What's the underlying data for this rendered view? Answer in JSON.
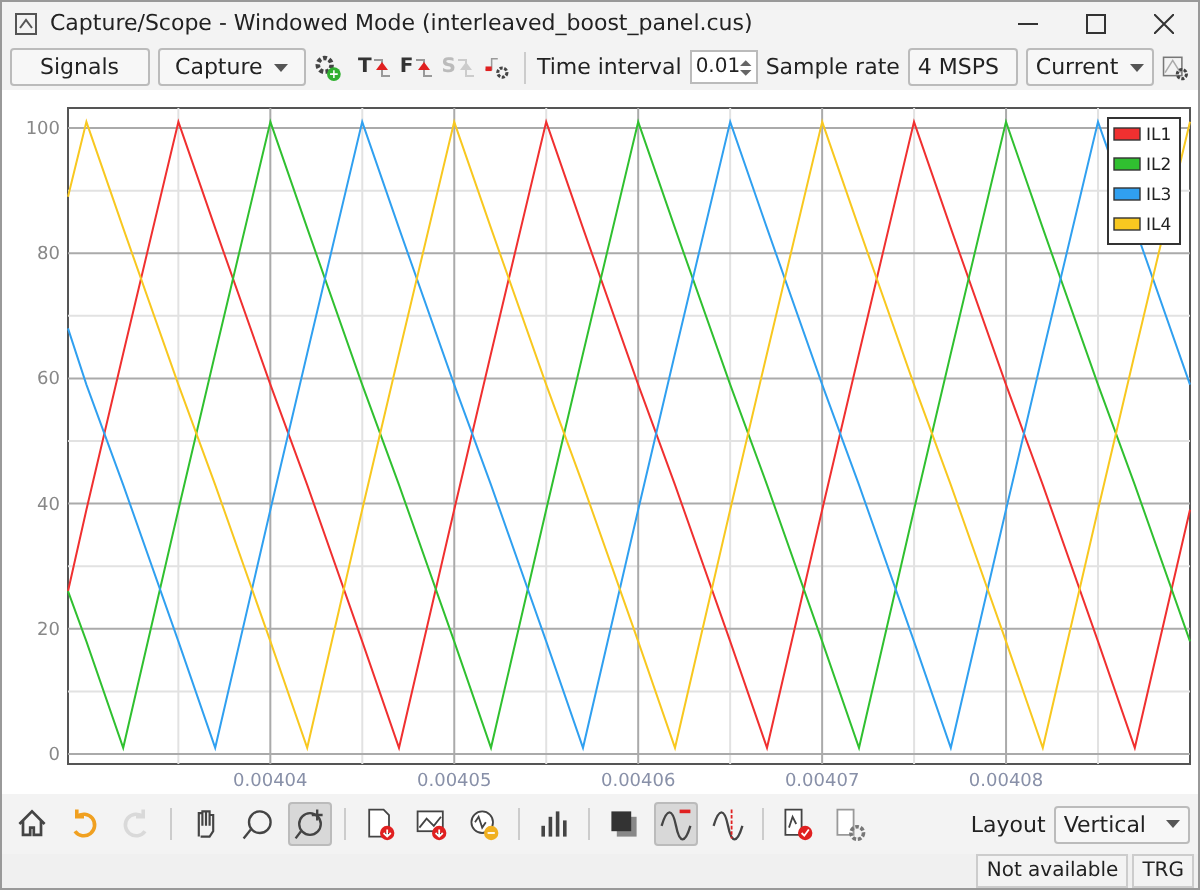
{
  "window": {
    "title": "Capture/Scope - Windowed Mode (interleaved_boost_panel.cus)"
  },
  "toolbar": {
    "signals_button": "Signals",
    "mode": "Capture",
    "triggers": [
      {
        "letter": "T",
        "disabled": false
      },
      {
        "letter": "F",
        "disabled": false
      },
      {
        "letter": "S",
        "disabled": true
      }
    ],
    "time_interval": {
      "label": "Time interval",
      "value": "0.01"
    },
    "sample_rate": {
      "label": "Sample rate",
      "value": "4 MSPS"
    },
    "channel": "Current"
  },
  "plot": {
    "chart_data": {
      "type": "line",
      "x": [
        0.004029,
        0.00403,
        0.004032,
        0.004035,
        0.004037,
        0.00404,
        0.004042,
        0.004045,
        0.004047,
        0.00405,
        0.004052,
        0.004055,
        0.004057,
        0.00406,
        0.004062,
        0.004065,
        0.004067,
        0.00407,
        0.004072,
        0.004075,
        0.004077,
        0.00408,
        0.004082,
        0.004085,
        0.004087,
        0.00409
      ],
      "series": [
        {
          "name": "IL1",
          "color": "#f03030",
          "values": [
            26,
            39,
            64,
            101,
            84,
            59,
            43,
            18,
            1,
            39,
            64,
            101,
            84,
            59,
            43,
            18,
            1,
            39,
            64,
            101,
            84,
            59,
            43,
            18,
            1,
            39
          ]
        },
        {
          "name": "IL2",
          "color": "#30c030",
          "values": [
            26,
            18,
            1,
            39,
            64,
            101,
            84,
            59,
            43,
            18,
            1,
            39,
            64,
            101,
            84,
            59,
            43,
            18,
            1,
            39,
            64,
            101,
            84,
            59,
            43,
            18
          ]
        },
        {
          "name": "IL3",
          "color": "#30a0f0",
          "values": [
            68,
            59,
            43,
            18,
            1,
            39,
            64,
            101,
            84,
            59,
            43,
            18,
            1,
            39,
            64,
            101,
            84,
            59,
            43,
            18,
            1,
            39,
            64,
            101,
            null,
            59
          ]
        },
        {
          "name": "IL4",
          "color": "#f8c820",
          "values": [
            89,
            101,
            84,
            59,
            43,
            18,
            1,
            39,
            64,
            101,
            84,
            59,
            43,
            18,
            1,
            39,
            64,
            101,
            84,
            59,
            43,
            18,
            1,
            39,
            64,
            101
          ]
        }
      ],
      "grid": true,
      "legend": true,
      "xlim": [
        0.004029,
        0.00409
      ],
      "ylim": [
        -1.6,
        103.2
      ],
      "xticks": [
        {
          "value": 0.00404,
          "label": "0.00404"
        },
        {
          "value": 0.00405,
          "label": "0.00405"
        },
        {
          "value": 0.00406,
          "label": "0.00406"
        },
        {
          "value": 0.00407,
          "label": "0.00407"
        },
        {
          "value": 0.00408,
          "label": "0.00408"
        }
      ],
      "yticks": [
        0,
        20,
        40,
        60,
        80,
        100
      ]
    }
  },
  "bottom_toolbar": {
    "groups": [
      [
        {
          "kind": "home",
          "pressed": false,
          "disabled": false
        },
        {
          "kind": "undo",
          "pressed": false,
          "disabled": false
        },
        {
          "kind": "redo",
          "pressed": false,
          "disabled": true
        }
      ],
      [
        {
          "kind": "pan",
          "pressed": false,
          "disabled": false
        },
        {
          "kind": "zoom",
          "pressed": false,
          "disabled": false
        },
        {
          "kind": "zoom-add",
          "pressed": true,
          "disabled": false
        }
      ],
      [
        {
          "kind": "export-doc",
          "pressed": false,
          "disabled": false
        },
        {
          "kind": "export-image",
          "pressed": false,
          "disabled": false
        },
        {
          "kind": "export-signal",
          "pressed": false,
          "disabled": false
        }
      ],
      [
        {
          "kind": "bars",
          "pressed": false,
          "disabled": false
        }
      ],
      [
        {
          "kind": "fill",
          "pressed": false,
          "disabled": false
        },
        {
          "kind": "wave",
          "pressed": true,
          "disabled": false
        },
        {
          "kind": "cursor-wave",
          "pressed": false,
          "disabled": false
        }
      ],
      [
        {
          "kind": "check-doc",
          "pressed": false,
          "disabled": false
        },
        {
          "kind": "settings-doc",
          "pressed": false,
          "disabled": false
        }
      ]
    ],
    "layout": {
      "label": "Layout",
      "value": "Vertical"
    }
  },
  "status_bar": [
    "Not available",
    "TRG"
  ]
}
